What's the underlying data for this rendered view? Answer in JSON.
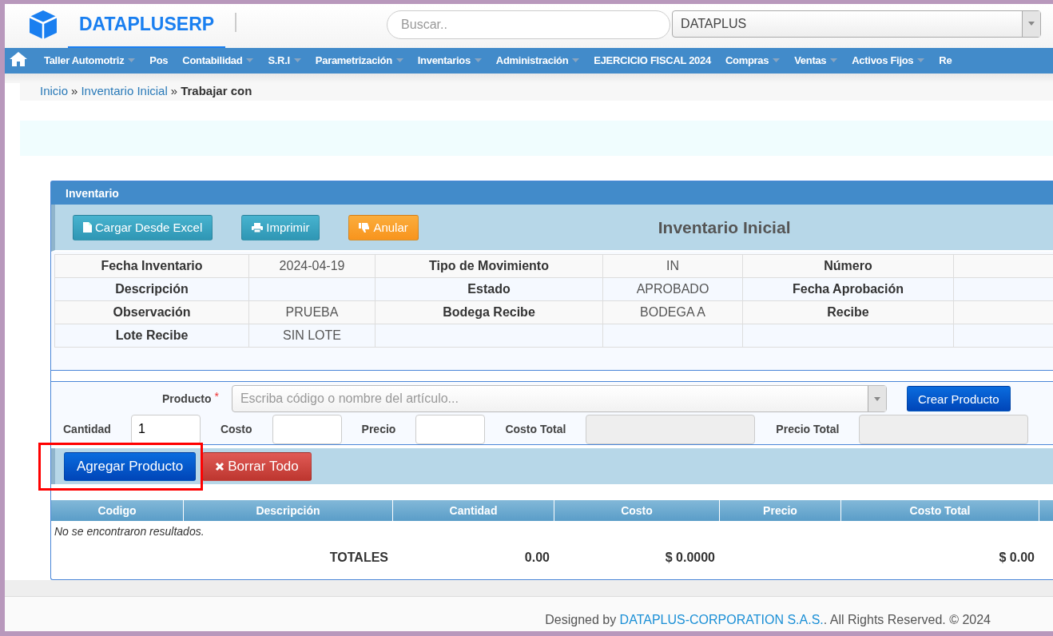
{
  "header": {
    "brand": "DATAPLUSERP",
    "search": {
      "placeholder": "Buscar.."
    },
    "company_select": {
      "value": "DATAPLUS"
    }
  },
  "menu": [
    {
      "label": "Taller Automotriz",
      "dropdown": true
    },
    {
      "label": "Pos",
      "dropdown": false
    },
    {
      "label": "Contabilidad",
      "dropdown": true
    },
    {
      "label": "S.R.I",
      "dropdown": true
    },
    {
      "label": "Parametrización",
      "dropdown": true
    },
    {
      "label": "Inventarios",
      "dropdown": true
    },
    {
      "label": "Administración",
      "dropdown": true
    },
    {
      "label": "EJERCICIO FISCAL 2024",
      "dropdown": false
    },
    {
      "label": "Compras",
      "dropdown": true
    },
    {
      "label": "Ventas",
      "dropdown": true
    },
    {
      "label": "Activos Fijos",
      "dropdown": true
    },
    {
      "label": "Re",
      "dropdown": false
    }
  ],
  "breadcrumb": [
    {
      "kind": "link",
      "text": "Inicio"
    },
    {
      "kind": "separator",
      "text": "»"
    },
    {
      "kind": "link",
      "text": "Inventario Inicial"
    },
    {
      "kind": "separator",
      "text": "»"
    },
    {
      "kind": "current",
      "text": "Trabajar con"
    }
  ],
  "panel": {
    "title": "Inventario",
    "heading": "Inventario Inicial",
    "toolbar": [
      {
        "label": "Cargar Desde Excel"
      },
      {
        "label": "Imprimir"
      },
      {
        "label": "Anular"
      }
    ],
    "details": [
      [
        {
          "kind": "label",
          "text": "Fecha Inventario"
        },
        {
          "kind": "value",
          "text": "2024-04-19"
        },
        {
          "kind": "label",
          "text": "Tipo de Movimiento"
        },
        {
          "kind": "value",
          "text": "IN"
        },
        {
          "kind": "label",
          "text": "Número"
        },
        {
          "kind": "value"
        }
      ],
      [
        {
          "kind": "label",
          "text": "Descripción"
        },
        {
          "kind": "value"
        },
        {
          "kind": "label",
          "text": "Estado"
        },
        {
          "kind": "value",
          "text": "APROBADO"
        },
        {
          "kind": "label",
          "text": "Fecha Aprobación"
        },
        {
          "kind": "value"
        }
      ],
      [
        {
          "kind": "label",
          "text": "Observación"
        },
        {
          "kind": "value",
          "text": "PRUEBA"
        },
        {
          "kind": "label",
          "text": "Bodega Recibe"
        },
        {
          "kind": "value",
          "text": "BODEGA A"
        },
        {
          "kind": "label",
          "text": "Recibe"
        },
        {
          "kind": "value"
        }
      ],
      [
        {
          "kind": "label",
          "text": "Lote Recibe"
        },
        {
          "kind": "value",
          "text": "SIN LOTE"
        },
        {
          "kind": "value"
        },
        {
          "kind": "value"
        },
        {
          "kind": "value"
        },
        {
          "kind": "value"
        }
      ]
    ]
  },
  "form": {
    "product": {
      "label": "Producto",
      "required_mark": "*",
      "placeholder": "Escriba código o nombre del artículo...",
      "create_button": "Crear Producto"
    },
    "fields": [
      {
        "label": "Cantidad",
        "value": "1",
        "disabled": false
      },
      {
        "label": "Costo",
        "disabled": false
      },
      {
        "label": "Precio",
        "disabled": false
      },
      {
        "label": "Costo Total",
        "disabled": true
      },
      {
        "label": "Precio Total",
        "disabled": true
      }
    ]
  },
  "actions": [
    {
      "label": "Agregar Producto",
      "highlighted": true
    },
    {
      "label": "Borrar Todo",
      "highlighted": false
    }
  ],
  "results": {
    "columns": [
      "Codigo",
      "Descripción",
      "Cantidad",
      "Costo",
      "Precio",
      "Costo Total"
    ],
    "empty_message": "No se encontraron resultados.",
    "totals": {
      "label": "TOTALES",
      "cantidad": "0.00",
      "costo": "$ 0.0000",
      "costo_total": "$ 0.00"
    }
  },
  "footer": {
    "prefix": "Designed by",
    "link": "DATAPLUS-CORPORATION S.A.S.",
    "suffix": ". All Rights Reserved. © 2024"
  }
}
